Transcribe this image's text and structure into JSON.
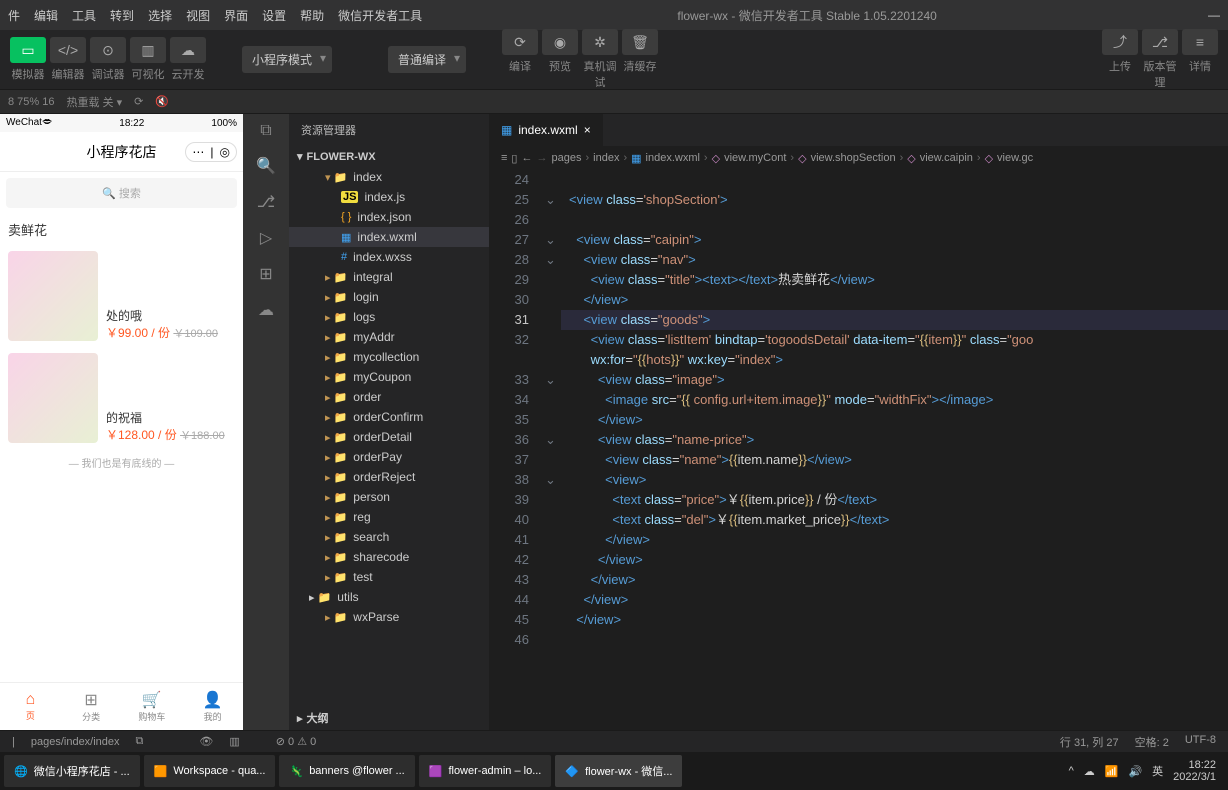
{
  "window": {
    "title": "flower-wx - 微信开发者工具 Stable 1.05.2201240"
  },
  "menu": [
    "件",
    "编辑",
    "工具",
    "转到",
    "选择",
    "视图",
    "界面",
    "设置",
    "帮助",
    "微信开发者工具"
  ],
  "toolbar": {
    "row1_labels": [
      "模拟器",
      "编辑器",
      "调试器",
      "可视化",
      "云开发"
    ],
    "mode": "小程序模式",
    "compile_mode": "普通编译",
    "actions": [
      "编译",
      "预览",
      "真机调试",
      "清缓存"
    ],
    "right": [
      "上传",
      "版本管理",
      "详情"
    ]
  },
  "status_row": {
    "zoom": "8 75% 16",
    "hot_reload": "热重载 关"
  },
  "simulator": {
    "status_left": "WeChat🗢",
    "status_time": "18:22",
    "status_right": "100%",
    "title": "小程序花店",
    "search_placeholder": "🔍 搜索",
    "section_title": "卖鲜花",
    "products": [
      {
        "name": "处的哦",
        "price": "￥99.00 / 份",
        "del": "￥109.00"
      },
      {
        "name": "的祝福",
        "price": "￥128.00 / 份",
        "del": "￥188.00"
      }
    ],
    "divider": "— 我们也是有底线的 —",
    "tabs": [
      "页",
      "分类",
      "购物车",
      "我的"
    ]
  },
  "explorer": {
    "header": "资源管理器",
    "project": "FLOWER-WX",
    "tree": [
      {
        "name": "index",
        "type": "folder",
        "depth": 0,
        "expanded": true
      },
      {
        "name": "index.js",
        "type": "js",
        "depth": 1
      },
      {
        "name": "index.json",
        "type": "json",
        "depth": 1
      },
      {
        "name": "index.wxml",
        "type": "wxml",
        "depth": 1,
        "active": true
      },
      {
        "name": "index.wxss",
        "type": "wxss",
        "depth": 1
      },
      {
        "name": "integral",
        "type": "folder",
        "depth": 0
      },
      {
        "name": "login",
        "type": "folder",
        "depth": 0
      },
      {
        "name": "logs",
        "type": "folder",
        "depth": 0
      },
      {
        "name": "myAddr",
        "type": "folder",
        "depth": 0
      },
      {
        "name": "mycollection",
        "type": "folder",
        "depth": 0
      },
      {
        "name": "myCoupon",
        "type": "folder",
        "depth": 0
      },
      {
        "name": "order",
        "type": "folder",
        "depth": 0
      },
      {
        "name": "orderConfirm",
        "type": "folder",
        "depth": 0
      },
      {
        "name": "orderDetail",
        "type": "folder",
        "depth": 0
      },
      {
        "name": "orderPay",
        "type": "folder",
        "depth": 0
      },
      {
        "name": "orderReject",
        "type": "folder",
        "depth": 0
      },
      {
        "name": "person",
        "type": "folder",
        "depth": 0
      },
      {
        "name": "reg",
        "type": "folder",
        "depth": 0
      },
      {
        "name": "search",
        "type": "folder",
        "depth": 0
      },
      {
        "name": "sharecode",
        "type": "folder",
        "depth": 0
      },
      {
        "name": "test",
        "type": "folder",
        "depth": 0
      },
      {
        "name": "utils",
        "type": "folder-green",
        "depth": -1
      },
      {
        "name": "wxParse",
        "type": "folder",
        "depth": 0
      }
    ],
    "outline": "大纲",
    "problems": "⊘ 0 ⚠ 0"
  },
  "editor": {
    "tab_name": "index.wxml",
    "breadcrumb": [
      "pages",
      "index",
      "index.wxml",
      "view.myCont",
      "view.shopSection",
      "view.caipin",
      "view.gc"
    ],
    "active_line": 31,
    "lines": [
      {
        "n": 24
      },
      {
        "n": 25,
        "fold": true,
        "html": "<span class='tag'>&lt;view</span> <span class='attr'>class</span>=<span class='str'>'shopSection'</span><span class='tag'>&gt;</span>"
      },
      {
        "n": 26
      },
      {
        "n": 27,
        "fold": true,
        "html": "  <span class='tag'>&lt;view</span> <span class='attr'>class</span>=<span class='str2'>\"caipin\"</span><span class='tag'>&gt;</span>"
      },
      {
        "n": 28,
        "fold": true,
        "html": "    <span class='tag'>&lt;view</span> <span class='attr'>class</span>=<span class='str2'>\"nav\"</span><span class='tag'>&gt;</span>"
      },
      {
        "n": 29,
        "html": "      <span class='tag'>&lt;view</span> <span class='attr'>class</span>=<span class='str2'>\"title\"</span><span class='tag'>&gt;&lt;text&gt;&lt;/text&gt;</span>热卖鲜花<span class='tag'>&lt;/view&gt;</span>"
      },
      {
        "n": 30,
        "html": "    <span class='tag'>&lt;/view&gt;</span>"
      },
      {
        "n": 31,
        "hl": true,
        "html": "    <span class='tag'>&lt;view</span> <span class='attr'>class</span>=<span class='str2'>\"goods\"</span><span class='tag'>&gt;</span>"
      },
      {
        "n": 32,
        "html": "      <span class='tag'>&lt;view</span> <span class='attr'>class</span>=<span class='str'>'listItem'</span> <span class='attr'>bindtap</span>=<span class='str'>'togoodsDetail'</span> <span class='attr'>data-item</span>=<span class='str2'>\"<span class='brace'>{{</span>item<span class='brace'>}}</span>\"</span> <span class='attr'>class</span>=<span class='str2'>\"goo</span>"
      },
      {
        "n": "",
        "html": "      <span class='attr'>wx:for</span>=<span class='str2'>\"<span class='brace'>{{</span>hots<span class='brace'>}}</span>\"</span> <span class='attr'>wx:key</span>=<span class='str2'>\"index\"</span><span class='tag'>&gt;</span>"
      },
      {
        "n": 33,
        "fold": true,
        "html": "        <span class='tag'>&lt;view</span> <span class='attr'>class</span>=<span class='str2'>\"image\"</span><span class='tag'>&gt;</span>"
      },
      {
        "n": 34,
        "html": "          <span class='tag'>&lt;image</span> <span class='attr'>src</span>=<span class='str2'>\"<span class='brace'>{{</span> config.url+item.image<span class='brace'>}}</span>\"</span> <span class='attr'>mode</span>=<span class='str2'>\"widthFix\"</span><span class='tag'>&gt;&lt;/image&gt;</span>"
      },
      {
        "n": 35,
        "html": "        <span class='tag'>&lt;/view&gt;</span>"
      },
      {
        "n": 36,
        "fold": true,
        "html": "        <span class='tag'>&lt;view</span> <span class='attr'>class</span>=<span class='str2'>\"name-price\"</span><span class='tag'>&gt;</span>"
      },
      {
        "n": 37,
        "html": "          <span class='tag'>&lt;view</span> <span class='attr'>class</span>=<span class='str2'>\"name\"</span><span class='tag'>&gt;</span><span class='brace'>{{</span>item.name<span class='brace'>}}</span><span class='tag'>&lt;/view&gt;</span>"
      },
      {
        "n": 38,
        "fold": true,
        "html": "          <span class='tag'>&lt;view&gt;</span>"
      },
      {
        "n": 39,
        "html": "            <span class='tag'>&lt;text</span> <span class='attr'>class</span>=<span class='str2'>\"price\"</span><span class='tag'>&gt;</span>￥<span class='brace'>{{</span>item.price<span class='brace'>}}</span> / 份<span class='tag'>&lt;/text&gt;</span>"
      },
      {
        "n": 40,
        "html": "            <span class='tag'>&lt;text</span> <span class='attr'>class</span>=<span class='str2'>\"del\"</span><span class='tag'>&gt;</span>￥<span class='brace'>{{</span>item.market_price<span class='brace'>}}</span><span class='tag'>&lt;/text&gt;</span>"
      },
      {
        "n": 41,
        "html": "          <span class='tag'>&lt;/view&gt;</span>"
      },
      {
        "n": 42,
        "html": "        <span class='tag'>&lt;/view&gt;</span>"
      },
      {
        "n": 43,
        "html": "      <span class='tag'>&lt;/view&gt;</span>"
      },
      {
        "n": 44,
        "html": "    <span class='tag'>&lt;/view&gt;</span>"
      },
      {
        "n": 45,
        "html": "  <span class='tag'>&lt;/view&gt;</span>"
      },
      {
        "n": 46
      }
    ]
  },
  "statusbar": {
    "left_path": "pages/index/index",
    "position": "行 31, 列 27",
    "spaces": "空格: 2",
    "encoding": "UTF-8"
  },
  "taskbar": {
    "items": [
      "微信小程序花店 - ...",
      "Workspace - qua...",
      "banners @flower ...",
      "flower-admin – lo...",
      "flower-wx - 微信..."
    ],
    "time": "18:22",
    "date": "2022/3/1",
    "ime": "英"
  }
}
